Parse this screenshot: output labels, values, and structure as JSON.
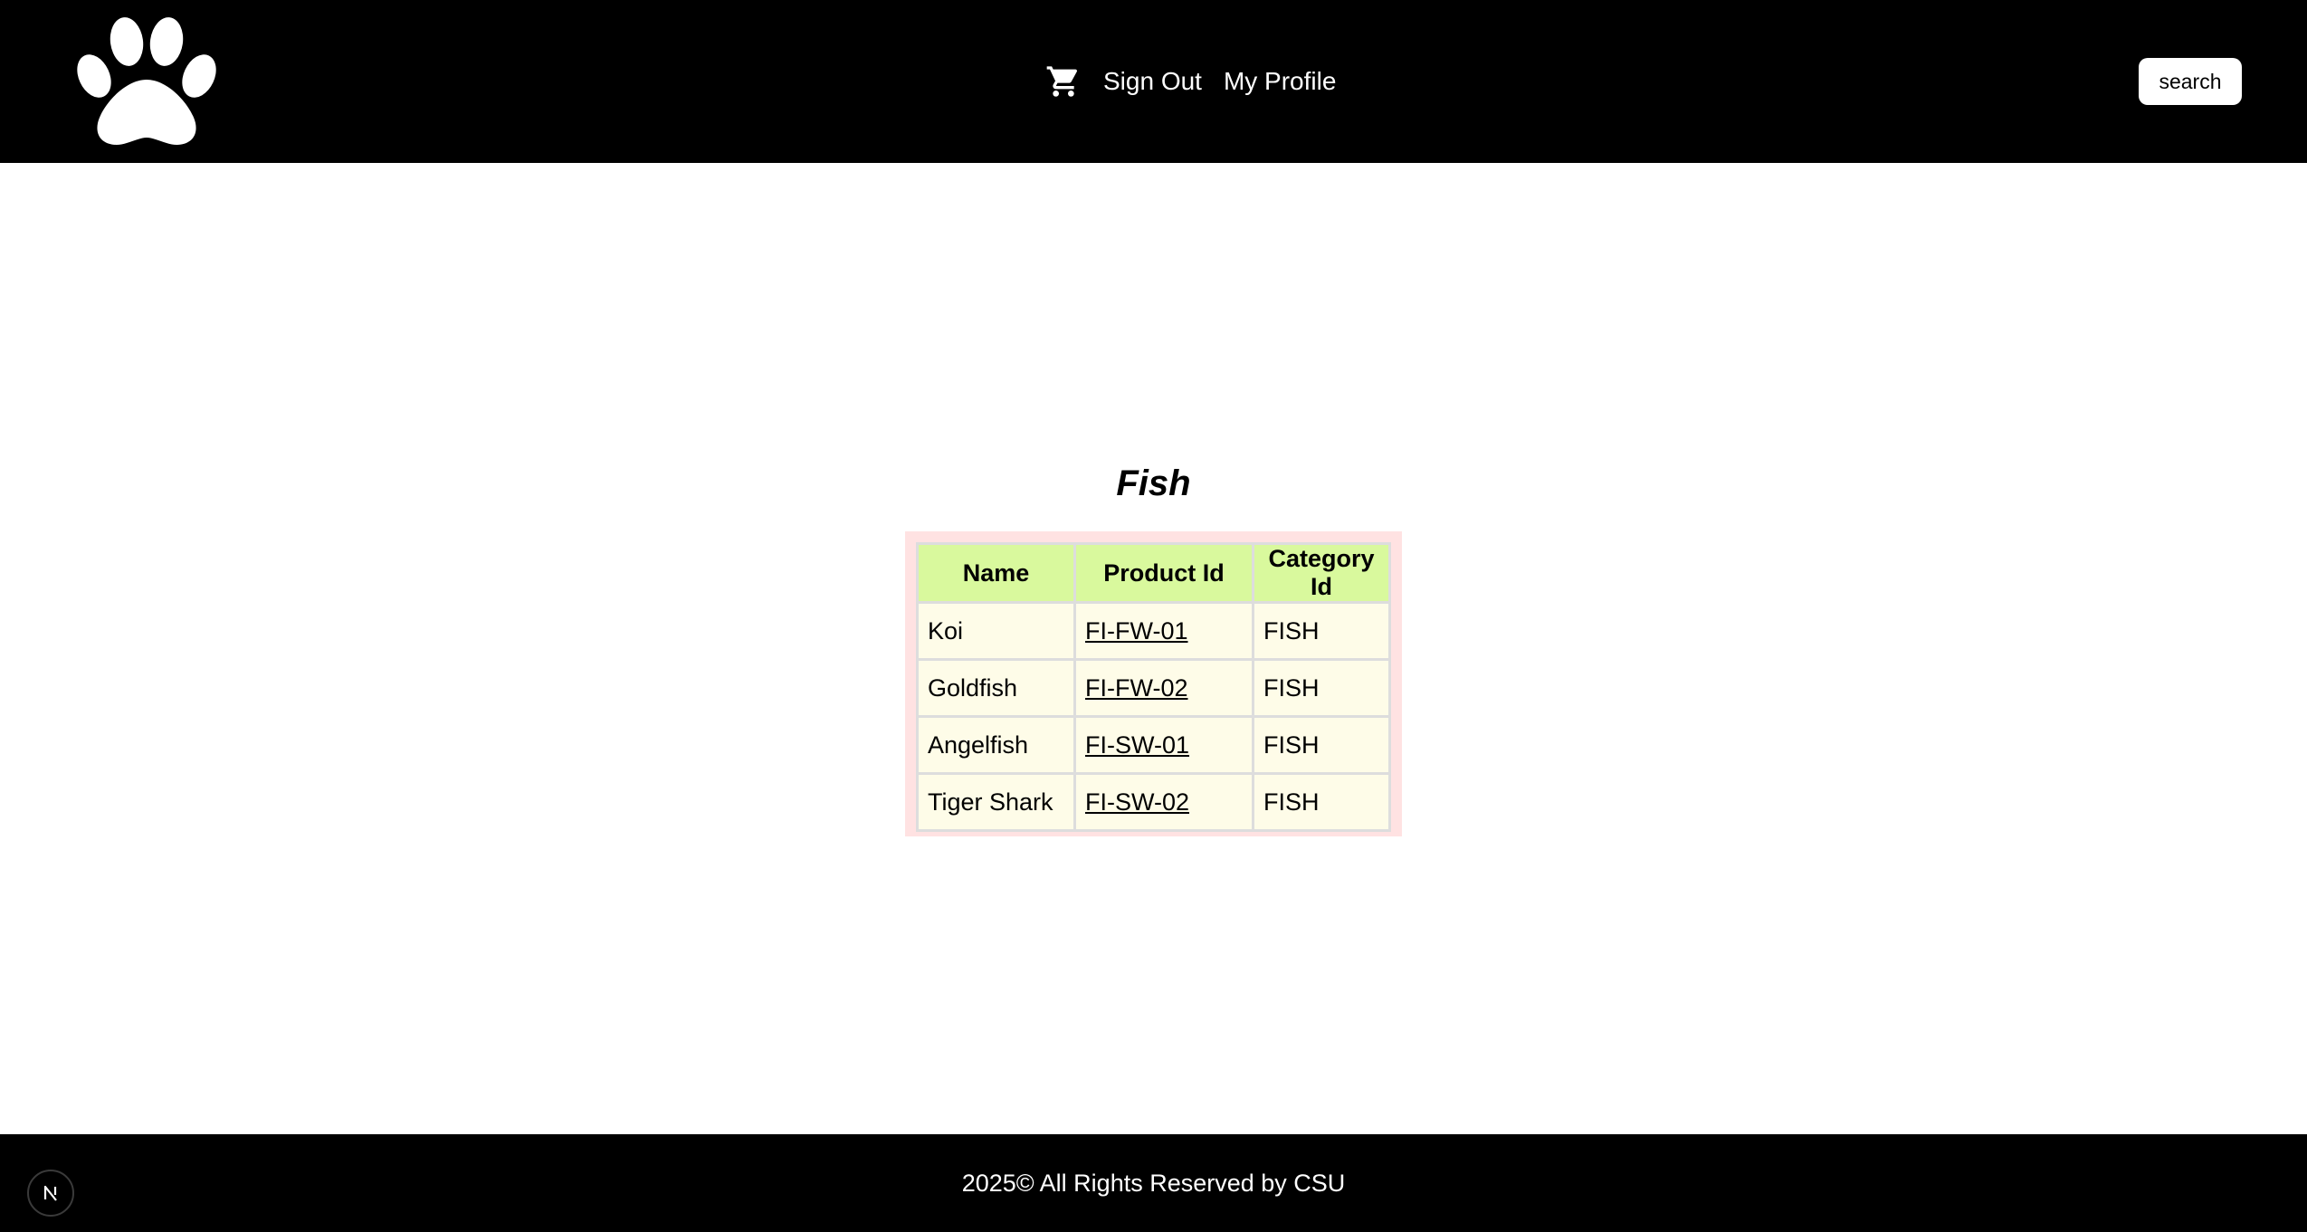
{
  "header": {
    "logo_icon": "paw-icon",
    "cart_icon": "cart-icon",
    "nav": [
      {
        "label": "Sign Out"
      },
      {
        "label": "My Profile"
      }
    ],
    "search_label": "search"
  },
  "main": {
    "title": "Fish",
    "table": {
      "columns": [
        "Name",
        "Product Id",
        "Category Id"
      ],
      "rows": [
        {
          "name": "Koi",
          "product_id": "FI-FW-01",
          "category_id": "FISH"
        },
        {
          "name": "Goldfish",
          "product_id": "FI-FW-02",
          "category_id": "FISH"
        },
        {
          "name": "Angelfish",
          "product_id": "FI-SW-01",
          "category_id": "FISH"
        },
        {
          "name": "Tiger Shark",
          "product_id": "FI-SW-02",
          "category_id": "FISH"
        }
      ]
    }
  },
  "footer": {
    "copyright": "2025© All Rights Reserved by CSU",
    "badge_icon": "nextjs-icon"
  },
  "colors": {
    "header_bg": "#000000",
    "table_frame": "#ffe2e2",
    "table_header_bg": "#d9f99d",
    "table_cell_bg": "#fefce8"
  }
}
